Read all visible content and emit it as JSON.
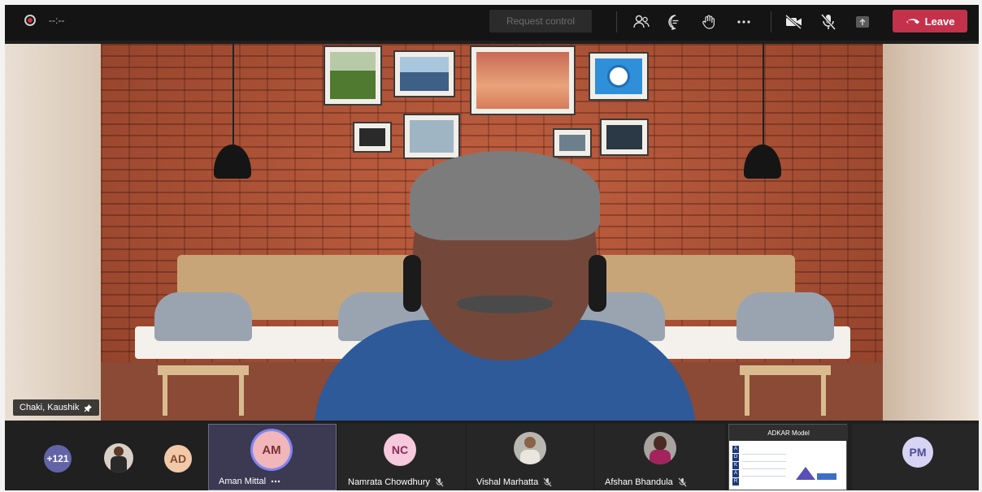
{
  "toolbar": {
    "timer": "--:--",
    "request_control_label": "Request control",
    "leave_label": "Leave",
    "icons": [
      "participants-icon",
      "chat-icon",
      "raise-hand-icon",
      "more-icon",
      "camera-off-icon",
      "mic-off-icon",
      "share-icon"
    ],
    "colors": {
      "leave": "#c4314b",
      "record": "#d13438"
    }
  },
  "main_video": {
    "speaker_name": "Chaki, Kaushik",
    "pinned": true
  },
  "strip": {
    "overflow_count": "+121",
    "participants": [
      {
        "initials": "AD",
        "color": "#f1c9a8",
        "text_color": "#7d4d33"
      },
      {
        "initials": "AM",
        "name": "Aman Mittal",
        "color": "#f0b6b9",
        "text_color": "#7a2f3b",
        "speaking": true
      },
      {
        "initials": "NC",
        "name": "Namrata Chowdhury",
        "color": "#f6c9dc",
        "text_color": "#8b2b58",
        "muted": true
      },
      {
        "name": "Vishal Marhatta",
        "muted": true
      },
      {
        "name": "Afshan Bhandula",
        "muted": true
      },
      {
        "initials": "PM",
        "color": "#d7d4f3",
        "text_color": "#4f4a99"
      }
    ],
    "shared_slide": {
      "title": "ADKAR Model",
      "letters": [
        "A",
        "D",
        "K",
        "A",
        "R"
      ]
    }
  }
}
